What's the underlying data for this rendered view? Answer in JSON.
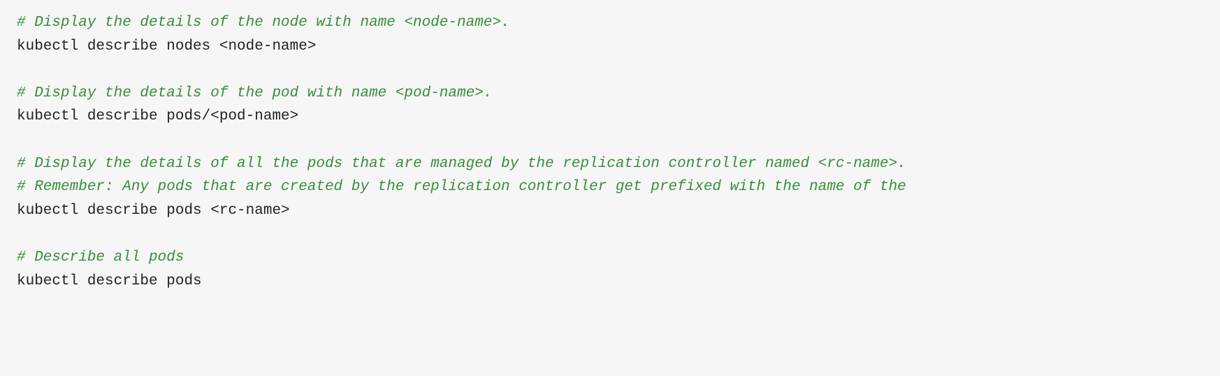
{
  "lines": [
    {
      "type": "comment",
      "text": "# Display the details of the node with name <node-name>."
    },
    {
      "type": "code",
      "text": "kubectl describe nodes <node-name>"
    },
    {
      "type": "blank",
      "text": ""
    },
    {
      "type": "comment",
      "text": "# Display the details of the pod with name <pod-name>."
    },
    {
      "type": "code",
      "text": "kubectl describe pods/<pod-name>"
    },
    {
      "type": "blank",
      "text": ""
    },
    {
      "type": "comment",
      "text": "# Display the details of all the pods that are managed by the replication controller named <rc-name>."
    },
    {
      "type": "comment",
      "text": "# Remember: Any pods that are created by the replication controller get prefixed with the name of the"
    },
    {
      "type": "code",
      "text": "kubectl describe pods <rc-name>"
    },
    {
      "type": "blank",
      "text": ""
    },
    {
      "type": "comment",
      "text": "# Describe all pods"
    },
    {
      "type": "code",
      "text": "kubectl describe pods"
    }
  ]
}
